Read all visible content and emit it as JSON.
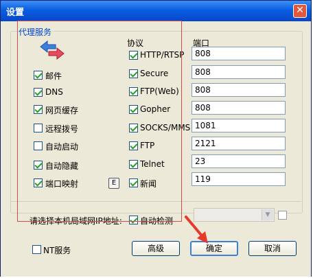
{
  "window": {
    "title": "设置",
    "close_icon": "close-icon"
  },
  "proxy_group": {
    "legend": "代理服务",
    "services": [
      {
        "label": "邮件",
        "checked": true
      },
      {
        "label": "DNS",
        "checked": true
      },
      {
        "label": "网页缓存",
        "checked": true
      },
      {
        "label": "远程拨号",
        "checked": false
      },
      {
        "label": "自动启动",
        "checked": false
      },
      {
        "label": "自动隐藏",
        "checked": true
      },
      {
        "label": "端口映射",
        "checked": true
      }
    ],
    "port_map_button": "E",
    "protocol_header": "协议",
    "port_header": "端口",
    "protocols": [
      {
        "label": "HTTP/RTSP",
        "checked": true,
        "port": "808"
      },
      {
        "label": "Secure",
        "checked": true,
        "port": "808"
      },
      {
        "label": "FTP(Web)",
        "checked": true,
        "port": "808"
      },
      {
        "label": "Gopher",
        "checked": true,
        "port": "808"
      },
      {
        "label": "SOCKS/MMS",
        "checked": true,
        "port": "1081"
      },
      {
        "label": "FTP",
        "checked": true,
        "port": "2121"
      },
      {
        "label": "Telnet",
        "checked": true,
        "port": "23"
      },
      {
        "label": "新闻",
        "checked": true,
        "port": "119"
      }
    ]
  },
  "ip_row": {
    "label": "请选择本机局域网IP地址:",
    "auto_detect_label": "自动检测",
    "auto_detect_checked": true
  },
  "bottom": {
    "nt_service_label": "NT服务",
    "nt_service_checked": false,
    "advanced_button": "高级",
    "ok_button": "确定",
    "cancel_button": "取消"
  },
  "accent_colors": {
    "title_bar": "#0a5ee0",
    "legend_text": "#0046d5",
    "highlight_box": "#d64a4a",
    "arrow": "#e8382a"
  }
}
